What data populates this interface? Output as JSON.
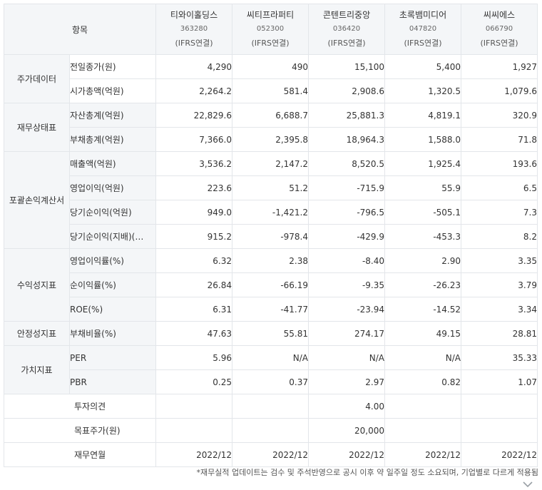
{
  "header": {
    "item_label": "항목",
    "companies": [
      {
        "name": "티와이홀딩스",
        "code": "363280",
        "basis": "(IFRS연결)"
      },
      {
        "name": "씨티프라퍼티",
        "code": "052300",
        "basis": "(IFRS연결)"
      },
      {
        "name": "콘텐트리중앙",
        "code": "036420",
        "basis": "(IFRS연결)"
      },
      {
        "name": "초록뱀미디어",
        "code": "047820",
        "basis": "(IFRS연결)"
      },
      {
        "name": "씨씨에스",
        "code": "066790",
        "basis": "(IFRS연결)"
      }
    ]
  },
  "categories": {
    "stock": "주가데이터",
    "balance": "재무상태표",
    "income": "포괄손익계산서",
    "profit": "수익성지표",
    "stability": "안정성지표",
    "value": "가치지표"
  },
  "rows": [
    {
      "label": "전일종가(원)",
      "values": [
        "4,290",
        "490",
        "15,100",
        "5,400",
        "1,927"
      ]
    },
    {
      "label": "시가총액(억원)",
      "values": [
        "2,264.2",
        "581.4",
        "2,908.6",
        "1,320.5",
        "1,079.6"
      ]
    },
    {
      "label": "자산총계(억원)",
      "values": [
        "22,829.6",
        "6,688.7",
        "25,881.3",
        "4,819.1",
        "320.9"
      ]
    },
    {
      "label": "부채총계(억원)",
      "values": [
        "7,366.0",
        "2,395.8",
        "18,964.3",
        "1,588.0",
        "71.8"
      ]
    },
    {
      "label": "매출액(억원)",
      "values": [
        "3,536.2",
        "2,147.2",
        "8,520.5",
        "1,925.4",
        "193.6"
      ]
    },
    {
      "label": "영업이익(억원)",
      "values": [
        "223.6",
        "51.2",
        "-715.9",
        "55.9",
        "6.5"
      ]
    },
    {
      "label": "당기순이익(억원)",
      "values": [
        "949.0",
        "-1,421.2",
        "-796.5",
        "-505.1",
        "7.3"
      ]
    },
    {
      "label": "당기순이익(지배)(…",
      "values": [
        "915.2",
        "-978.4",
        "-429.9",
        "-453.3",
        "8.2"
      ]
    },
    {
      "label": "영업이익률(%)",
      "values": [
        "6.32",
        "2.38",
        "-8.40",
        "2.90",
        "3.35"
      ]
    },
    {
      "label": "순이익률(%)",
      "values": [
        "26.84",
        "-66.19",
        "-9.35",
        "-26.23",
        "3.79"
      ]
    },
    {
      "label": "ROE(%)",
      "values": [
        "6.31",
        "-41.77",
        "-23.94",
        "-14.52",
        "3.34"
      ]
    },
    {
      "label": "부채비율(%)",
      "values": [
        "47.63",
        "55.81",
        "274.17",
        "49.15",
        "28.81"
      ]
    },
    {
      "label": "PER",
      "values": [
        "5.96",
        "N/A",
        "N/A",
        "N/A",
        "35.33"
      ]
    },
    {
      "label": "PBR",
      "values": [
        "0.25",
        "0.37",
        "2.97",
        "0.82",
        "1.07"
      ]
    },
    {
      "label": "투자의견",
      "values": [
        "",
        "",
        "4.00",
        "",
        ""
      ]
    },
    {
      "label": "목표주가(원)",
      "values": [
        "",
        "",
        "20,000",
        "",
        ""
      ]
    },
    {
      "label": "재무연월",
      "values": [
        "2022/12",
        "2022/12",
        "2022/12",
        "2022/12",
        "2022/12"
      ]
    }
  ],
  "footnote": "*재무실적 업데이트는 검수 및 주석반영으로 공시 이후 약 일주일 정도 소요되며, 기업별로 다르게 적용됨",
  "icons": {
    "expand": "chevron-down-icon"
  }
}
